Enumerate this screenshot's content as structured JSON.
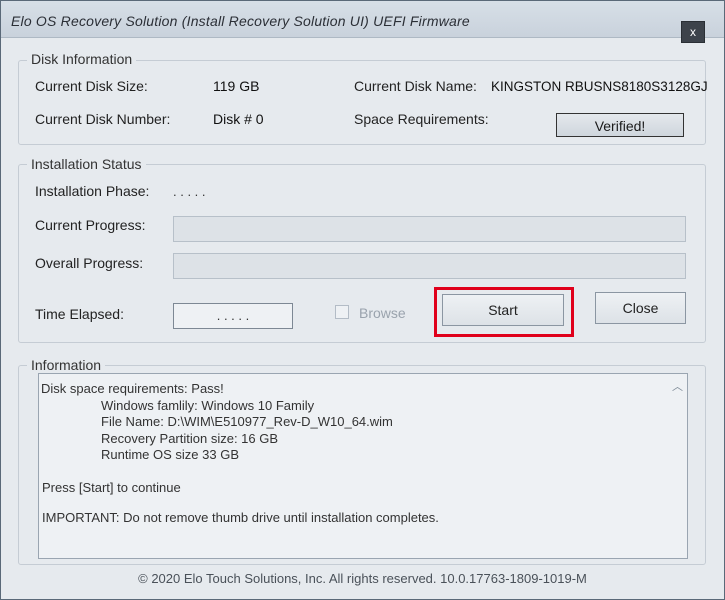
{
  "window": {
    "title": "Elo OS Recovery Solution (Install Recovery Solution UI) UEFI Firmware",
    "close_glyph": "x"
  },
  "disk_info": {
    "group_label": "Disk Information",
    "size_label": "Current Disk Size:",
    "size_value": "119 GB",
    "name_label": "Current Disk Name:",
    "name_value": "KINGSTON RBUSNS8180S3128GJ",
    "number_label": "Current Disk Number:",
    "number_value": "Disk # 0",
    "space_label": "Space Requirements:",
    "space_button": "Verified!"
  },
  "installation": {
    "group_label": "Installation Status",
    "phase_label": "Installation Phase:",
    "phase_value": ". . . . .",
    "current_label": "Current Progress:",
    "overall_label": "Overall Progress:",
    "elapsed_label": "Time Elapsed:",
    "elapsed_value": ". . . . .",
    "browse_label": "Browse",
    "start_label": "Start",
    "close_label": "Close"
  },
  "information": {
    "group_label": "Information",
    "lines": [
      "Disk space requirements: Pass!",
      "Windows famlily:  Windows 10 Family",
      "File Name:  D:\\WIM\\E510977_Rev-D_W10_64.wim",
      "Recovery Partition size:  16 GB",
      "Runtime OS size   33 GB",
      "Press [Start] to continue",
      "IMPORTANT:  Do not remove thumb drive until installation completes."
    ]
  },
  "footer": "© 2020 Elo Touch Solutions, Inc. All rights reserved. 10.0.17763-1809-1019-M",
  "colors": {
    "highlight": "#e0001b",
    "window_bg": "#e6eaee"
  },
  "icons": {
    "close": "close-icon",
    "scroll_up": "chevron-up-icon"
  }
}
